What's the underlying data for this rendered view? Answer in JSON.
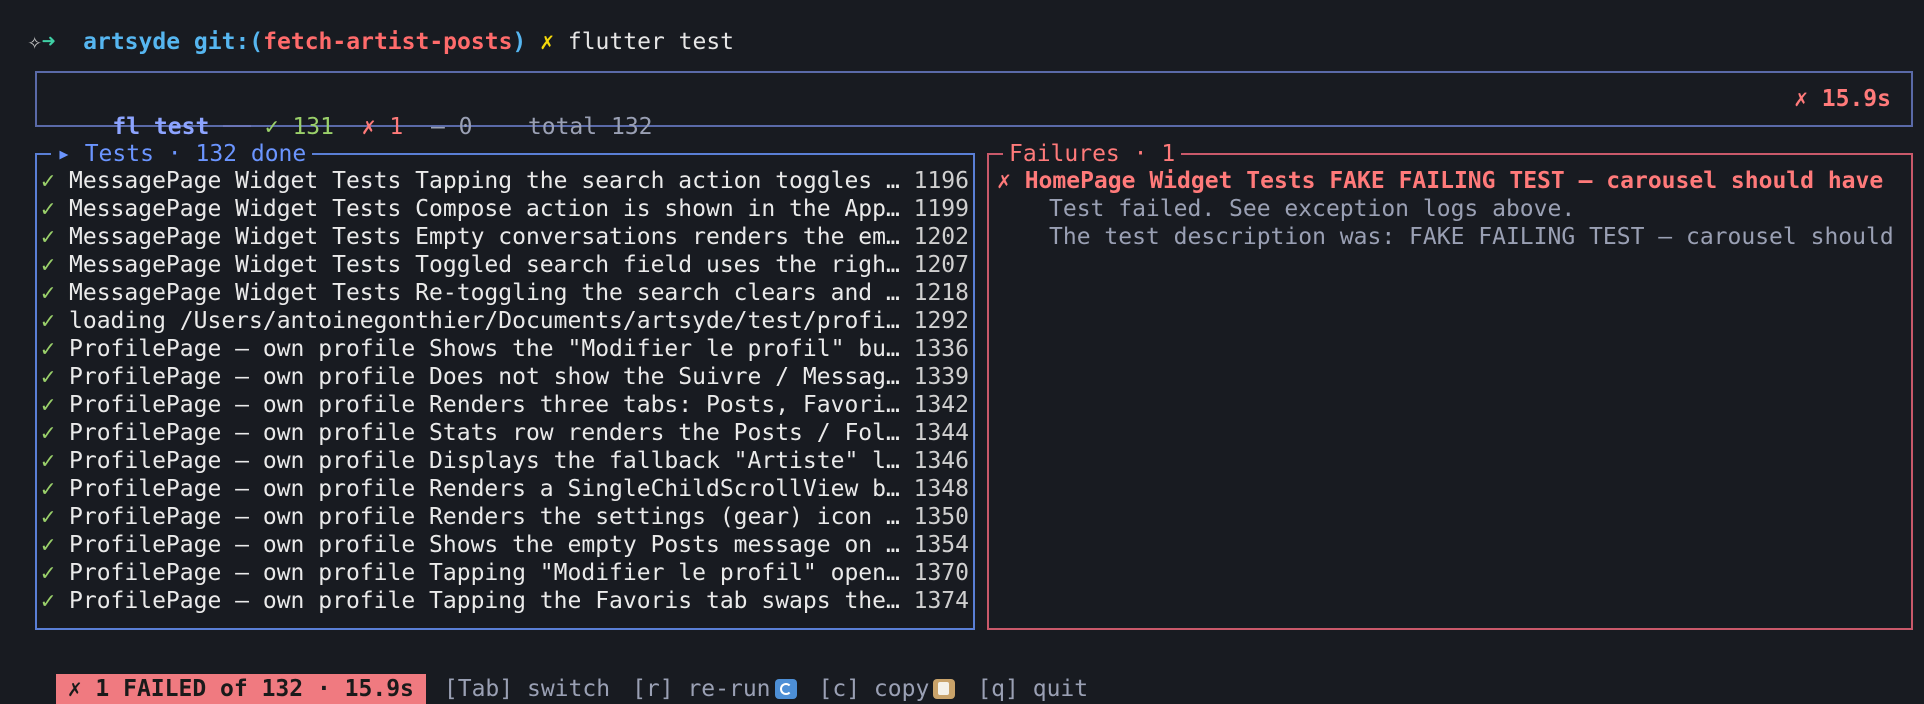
{
  "prompt": {
    "icon": "✧",
    "arrow": "➜",
    "directory": "artsyde",
    "git_label": "git:(",
    "branch": "fetch-artist-posts",
    "git_close": ")",
    "dirty_mark": "✗",
    "command": "flutter test"
  },
  "header": {
    "title": "fl test",
    "separator": "──",
    "passed": "✓ 131",
    "failed": "✗ 1",
    "skipped": "– 0",
    "total": "total 132",
    "duration": "✗ 15.9s"
  },
  "tests_panel": {
    "title": "▸ Tests · 132 done",
    "rows": [
      {
        "status": "✓",
        "name": "MessagePage Widget Tests Tapping the search action toggles the search field",
        "line": "1196"
      },
      {
        "status": "✓",
        "name": "MessagePage Widget Tests Compose action is shown in the AppBar",
        "line": "1199"
      },
      {
        "status": "✓",
        "name": "MessagePage Widget Tests Empty conversations renders the empty state",
        "line": "1202"
      },
      {
        "status": "✓",
        "name": "MessagePage Widget Tests Toggled search field uses the right hint",
        "line": "1207"
      },
      {
        "status": "✓",
        "name": "MessagePage Widget Tests Re-toggling the search clears and hides the field",
        "line": "1218"
      },
      {
        "status": "✓",
        "name": "loading /Users/antoinegonthier/Documents/artsyde/test/profile_page_test.dart",
        "line": "1292"
      },
      {
        "status": "✓",
        "name": "ProfilePage — own profile Shows the \"Modifier le profil\" button",
        "line": "1336"
      },
      {
        "status": "✓",
        "name": "ProfilePage — own profile Does not show the Suivre / Message buttons",
        "line": "1339"
      },
      {
        "status": "✓",
        "name": "ProfilePage — own profile Renders three tabs: Posts, Favoris, Likes",
        "line": "1342"
      },
      {
        "status": "✓",
        "name": "ProfilePage — own profile Stats row renders the Posts / Followers counts",
        "line": "1344"
      },
      {
        "status": "✓",
        "name": "ProfilePage — own profile Displays the fallback \"Artiste\" label",
        "line": "1346"
      },
      {
        "status": "✓",
        "name": "ProfilePage — own profile Renders a SingleChildScrollView body",
        "line": "1348"
      },
      {
        "status": "✓",
        "name": "ProfilePage — own profile Renders the settings (gear) icon in the AppBar",
        "line": "1350"
      },
      {
        "status": "✓",
        "name": "ProfilePage — own profile Shows the empty Posts message on empty feed",
        "line": "1354"
      },
      {
        "status": "✓",
        "name": "ProfilePage — own profile Tapping \"Modifier le profil\" opens the editor",
        "line": "1370"
      },
      {
        "status": "✓",
        "name": "ProfilePage — own profile Tapping the Favoris tab swaps the content",
        "line": "1374"
      }
    ]
  },
  "failures_panel": {
    "title": "Failures · 1",
    "items": [
      {
        "title": "✗ HomePage Widget Tests FAKE FAILING TEST — carousel should have",
        "details": [
          "Test failed. See exception logs above.",
          "The test description was: FAKE FAILING TEST — carousel should"
        ]
      }
    ]
  },
  "status_bar": {
    "badge": "✗ 1 FAILED of 132 · 15.9s",
    "switch": "[Tab] switch",
    "rerun": "[r] re-run",
    "rerun_icon": "rerun-icon",
    "copy": "[c] copy",
    "copy_icon": "clipboard-icon",
    "quit": "[q] quit"
  },
  "colors": {
    "background": "#181b21",
    "pass": "#9ad06a",
    "fail": "#ff7a7a",
    "accent": "#6b95ff",
    "branch": "#ff6b6b"
  }
}
